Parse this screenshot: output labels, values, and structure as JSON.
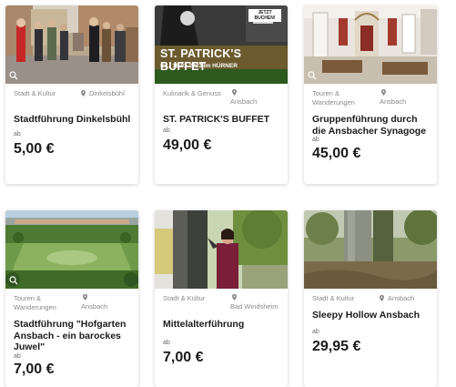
{
  "cards": [
    {
      "category": "Stadt & Kultur",
      "location": "Dinkelsbühl",
      "title": "Stadtführung Dinkelsbühl",
      "from_label": "ab",
      "price": "5,00 €"
    },
    {
      "category": "Kulinarik & Genuss",
      "location": "Ansbach",
      "title": "ST. PATRICK'S BUFFET",
      "from_label": "ab",
      "price": "49,00 €",
      "image_caption": "ST. PATRICK'S BUFFET",
      "image_subcaption": "Sa., 18.03.2023 im HÜRNER",
      "image_badge": "JETZT BUCHEN!"
    },
    {
      "category": "Touren & Wanderungen",
      "location": "Ansbach",
      "title": "Gruppenführung durch die Ansbacher Synagoge",
      "from_label": "ab",
      "price": "45,00 €"
    },
    {
      "category": "Touren & Wanderungen",
      "location": "Ansbach",
      "title": "Stadtführung \"Hofgarten Ansbach - ein barockes Juwel\"",
      "from_label": "ab",
      "price": "7,00 €"
    },
    {
      "category": "Stadt & Kultur",
      "location": "Bad Windsheim",
      "title": "Mittelalterführung",
      "from_label": "ab",
      "price": "7,00 €"
    },
    {
      "category": "Stadt & Kultur",
      "location": "Ansbach",
      "title": "Sleepy Hollow Ansbach",
      "from_label": "ab",
      "price": "29,95 €"
    }
  ],
  "icons": {
    "location": "map-pin-icon",
    "zoom": "magnifier-icon"
  },
  "colors": {
    "meta_text": "#8a8a8a",
    "title_text": "#1a1a1a"
  }
}
